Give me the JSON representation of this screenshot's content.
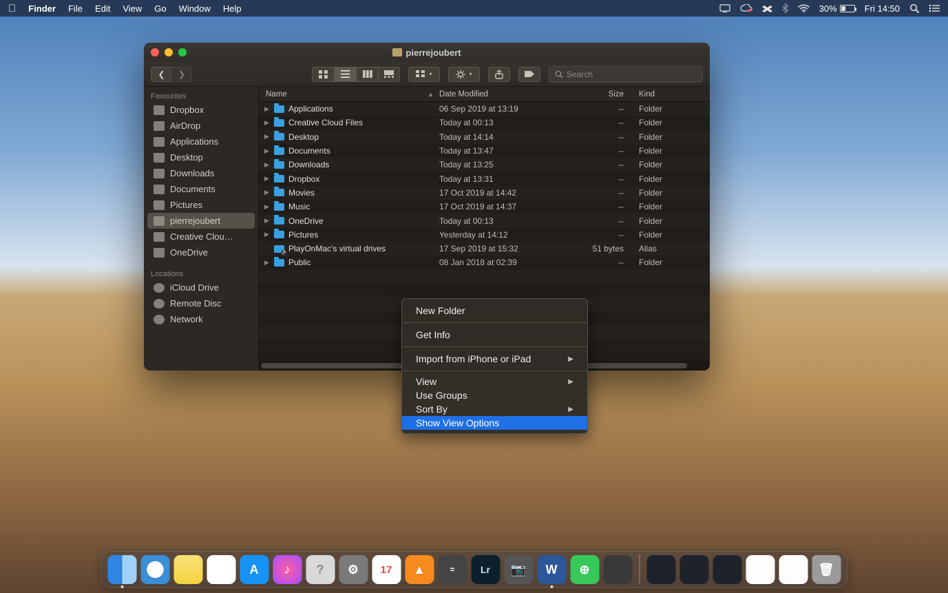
{
  "menubar": {
    "app": "Finder",
    "items": [
      "File",
      "Edit",
      "View",
      "Go",
      "Window",
      "Help"
    ],
    "battery_pct": "30%",
    "clock": "Fri 14:50"
  },
  "window": {
    "title": "pierrejoubert",
    "search_placeholder": "Search"
  },
  "columns": {
    "name": "Name",
    "date": "Date Modified",
    "size": "Size",
    "kind": "Kind"
  },
  "sidebar": {
    "favourites_label": "Favourites",
    "locations_label": "Locations",
    "favourites": [
      {
        "label": "Dropbox"
      },
      {
        "label": "AirDrop"
      },
      {
        "label": "Applications"
      },
      {
        "label": "Desktop"
      },
      {
        "label": "Downloads"
      },
      {
        "label": "Documents"
      },
      {
        "label": "Pictures"
      },
      {
        "label": "pierrejoubert",
        "selected": true
      },
      {
        "label": "Creative Clou…"
      },
      {
        "label": "OneDrive"
      }
    ],
    "locations": [
      {
        "label": "iCloud Drive"
      },
      {
        "label": "Remote Disc"
      },
      {
        "label": "Network"
      }
    ]
  },
  "files": [
    {
      "name": "Applications",
      "date": "06 Sep 2019 at 13:19",
      "size": "--",
      "kind": "Folder",
      "icon": "folder"
    },
    {
      "name": "Creative Cloud Files",
      "date": "Today at 00:13",
      "size": "--",
      "kind": "Folder",
      "icon": "folder"
    },
    {
      "name": "Desktop",
      "date": "Today at 14:14",
      "size": "--",
      "kind": "Folder",
      "icon": "folder"
    },
    {
      "name": "Documents",
      "date": "Today at 13:47",
      "size": "--",
      "kind": "Folder",
      "icon": "folder"
    },
    {
      "name": "Downloads",
      "date": "Today at 13:25",
      "size": "--",
      "kind": "Folder",
      "icon": "folder"
    },
    {
      "name": "Dropbox",
      "date": "Today at 13:31",
      "size": "--",
      "kind": "Folder",
      "icon": "folder"
    },
    {
      "name": "Movies",
      "date": "17 Oct 2019 at 14:42",
      "size": "--",
      "kind": "Folder",
      "icon": "folder"
    },
    {
      "name": "Music",
      "date": "17 Oct 2019 at 14:37",
      "size": "--",
      "kind": "Folder",
      "icon": "folder"
    },
    {
      "name": "OneDrive",
      "date": "Today at 00:13",
      "size": "--",
      "kind": "Folder",
      "icon": "folder"
    },
    {
      "name": "Pictures",
      "date": "Yesterday at 14:12",
      "size": "--",
      "kind": "Folder",
      "icon": "folder"
    },
    {
      "name": "PlayOnMac's virtual drives",
      "date": "17 Sep 2019 at 15:32",
      "size": "51 bytes",
      "kind": "Alias",
      "icon": "alias"
    },
    {
      "name": "Public",
      "date": "08 Jan 2018 at 02:39",
      "size": "--",
      "kind": "Folder",
      "icon": "folder"
    }
  ],
  "context_menu": {
    "groups": [
      [
        {
          "label": "New Folder"
        }
      ],
      [
        {
          "label": "Get Info"
        }
      ],
      [
        {
          "label": "Import from iPhone or iPad",
          "sub": true
        }
      ],
      [
        {
          "label": "View",
          "sub": true
        },
        {
          "label": "Use Groups"
        },
        {
          "label": "Sort By",
          "sub": true
        },
        {
          "label": "Show View Options",
          "highlight": true
        }
      ]
    ]
  }
}
